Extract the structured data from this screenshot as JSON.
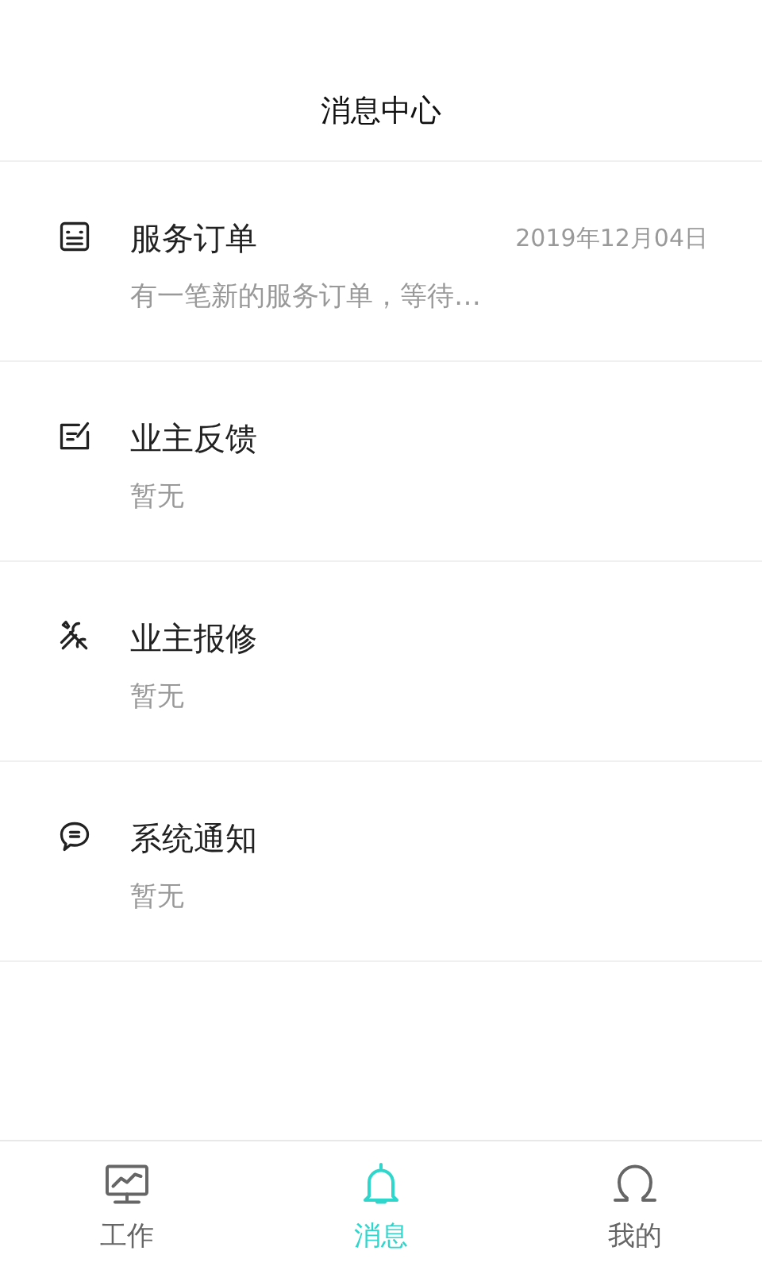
{
  "header": {
    "title": "消息中心"
  },
  "messages": [
    {
      "kind": "order",
      "title": "服务订单",
      "date": "2019年12月04日",
      "preview": "有一笔新的服务订单，等待…"
    },
    {
      "kind": "feedback",
      "title": "业主反馈",
      "preview": "暂无"
    },
    {
      "kind": "repair",
      "title": "业主报修",
      "preview": "暂无"
    },
    {
      "kind": "notice",
      "title": "系统通知",
      "preview": "暂无"
    }
  ],
  "tab_bar": [
    {
      "kind": "work",
      "label": "工作",
      "selected": false
    },
    {
      "kind": "messages",
      "label": "消息",
      "selected": true
    },
    {
      "kind": "me",
      "label": "我的",
      "selected": false
    }
  ]
}
